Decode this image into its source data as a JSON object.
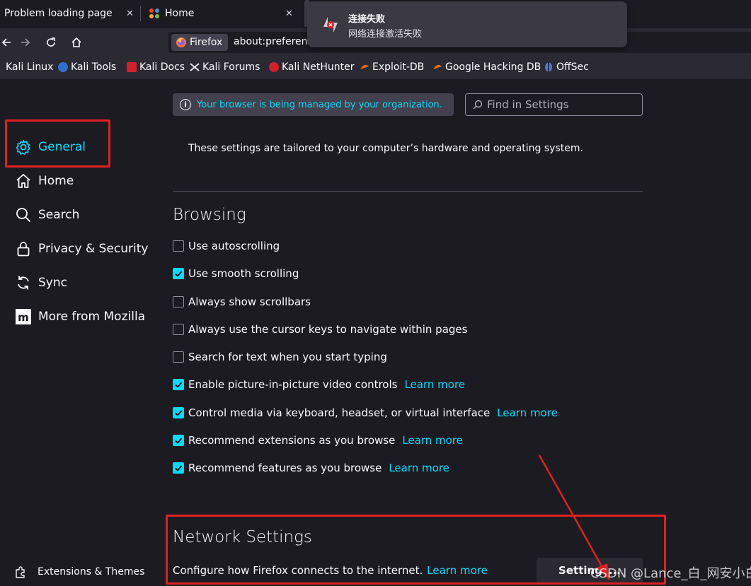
{
  "tabs": [
    {
      "title": "Problem loading page",
      "close": "✕"
    },
    {
      "title": "Home",
      "close": "✕"
    }
  ],
  "notification": {
    "title": "连接失败",
    "body": "网络连接激活失败"
  },
  "navbar": {
    "identity_label": "Firefox",
    "url": "about:preferences"
  },
  "bookmarks": [
    {
      "label": "Kali Linux",
      "color": "#5fa8d3"
    },
    {
      "label": "Kali Tools",
      "color": "#2f6fd0"
    },
    {
      "label": "Kali Docs",
      "color": "#d3212c"
    },
    {
      "label": "Kali Forums",
      "color": "#e8e8e8"
    },
    {
      "label": "Kali NetHunter",
      "color": "#d3212c"
    },
    {
      "label": "Exploit-DB",
      "color": "#e06c1e"
    },
    {
      "label": "Google Hacking DB",
      "color": "#e06c1e"
    },
    {
      "label": "OffSec",
      "color": "#4a7bd0"
    }
  ],
  "sidebar": {
    "items": [
      {
        "label": "General",
        "icon": "gear-icon",
        "selected": true
      },
      {
        "label": "Home",
        "icon": "home-icon"
      },
      {
        "label": "Search",
        "icon": "search-icon"
      },
      {
        "label": "Privacy & Security",
        "icon": "lock-icon"
      },
      {
        "label": "Sync",
        "icon": "sync-icon"
      },
      {
        "label": "More from Mozilla",
        "icon": "mozilla-icon"
      }
    ],
    "footer_label": "Extensions & Themes"
  },
  "main": {
    "policy_banner": "Your browser is being managed by your organization.",
    "find_placeholder": "Find in Settings",
    "tailored_text": "These settings are tailored to your computer’s hardware and operating system.",
    "browsing": {
      "heading": "Browsing",
      "options": [
        {
          "label": "Use autoscrolling",
          "checked": false,
          "link": ""
        },
        {
          "label": "Use smooth scrolling",
          "checked": true,
          "link": ""
        },
        {
          "label": "Always show scrollbars",
          "checked": false,
          "link": ""
        },
        {
          "label": "Always use the cursor keys to navigate within pages",
          "checked": false,
          "link": ""
        },
        {
          "label": "Search for text when you start typing",
          "checked": false,
          "link": ""
        },
        {
          "label": "Enable picture-in-picture video controls",
          "checked": true,
          "link": "Learn more"
        },
        {
          "label": "Control media via keyboard, headset, or virtual interface",
          "checked": true,
          "link": "Learn more"
        },
        {
          "label": "Recommend extensions as you browse",
          "checked": true,
          "link": "Learn more"
        },
        {
          "label": "Recommend features as you browse",
          "checked": true,
          "link": "Learn more"
        }
      ]
    },
    "network": {
      "heading": "Network Settings",
      "description": "Configure how Firefox connects to the internet.",
      "link": "Learn more",
      "button": "Settings..."
    }
  },
  "watermark": "CSDN @Lance_白_网安小白K",
  "colors": {
    "accent": "#00ddff",
    "annotation_red": "#e02020",
    "background": "#1c1b22"
  }
}
